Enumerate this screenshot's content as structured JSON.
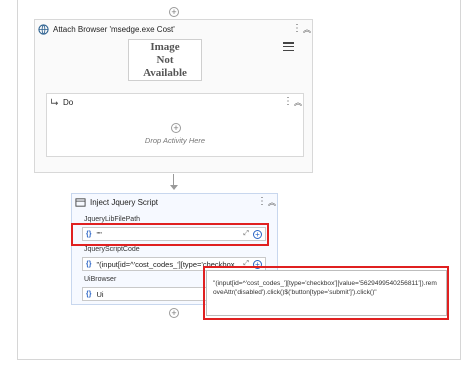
{
  "attach_browser": {
    "title": "Attach Browser 'msedge.exe Cost'",
    "image_placeholder": [
      "Image",
      "Not",
      "Available"
    ],
    "do_block": {
      "title": "Do",
      "drop_hint": "Drop Activity Here"
    }
  },
  "inject_script": {
    "title": "Inject Jquery Script",
    "fields": [
      {
        "label": "JqueryLibFilePath",
        "value": "\"\""
      },
      {
        "label": "JqueryScriptCode",
        "value": "\"(input[id=^'cost_codes_'][type='checkbox"
      },
      {
        "label": "UiBrowser",
        "value": "Ui"
      }
    ]
  },
  "tooltip": {
    "text": "\"(input[id=^'cost_codes_'][type='checkbox'][value='5629499540256811']).removeAttr('disabled').click()$('button[type='submit']').click()\""
  },
  "icons": {
    "plus": "+",
    "kebab": "⋮",
    "collapse": "︽",
    "curly": "{}",
    "expand": "⤢",
    "add": "+"
  },
  "colors": {
    "highlight": "#e02020",
    "accent": "#2a64c5"
  }
}
